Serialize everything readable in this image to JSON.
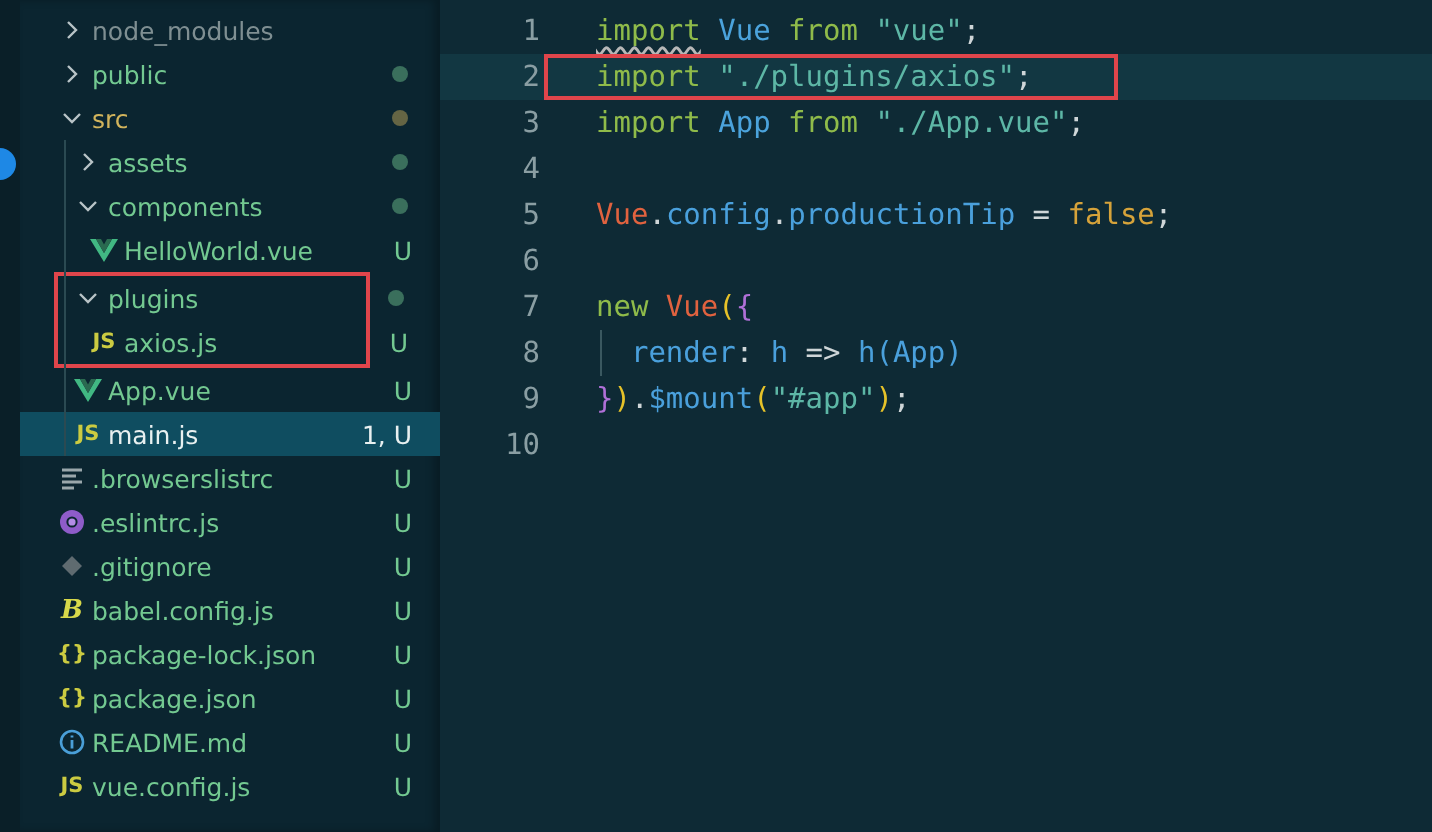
{
  "explorer": {
    "items": [
      {
        "label": "node_modules",
        "kind": "folder",
        "expanded": false,
        "color": "#7f8f92",
        "dot": false,
        "selected": false
      },
      {
        "label": "public",
        "kind": "folder",
        "expanded": false,
        "color": "#73c991",
        "dot": true,
        "selected": false
      },
      {
        "label": "src",
        "kind": "folder",
        "expanded": true,
        "color": "#d2b45c",
        "dot": true,
        "selected": false,
        "children": [
          {
            "label": "assets",
            "kind": "folder",
            "expanded": false,
            "color": "#73c991",
            "dot": true,
            "selected": false
          },
          {
            "label": "components",
            "kind": "folder",
            "expanded": true,
            "color": "#73c991",
            "dot": true,
            "selected": false,
            "children": [
              {
                "label": "HelloWorld.vue",
                "kind": "vue",
                "badge": "U",
                "color": "#73c991",
                "selected": false
              }
            ]
          },
          {
            "label": "plugins",
            "kind": "folder",
            "expanded": true,
            "color": "#73c991",
            "dot": true,
            "selected": false,
            "boxed": true,
            "children": [
              {
                "label": "axios.js",
                "kind": "js",
                "icon_glyph": "JS",
                "badge": "U",
                "color": "#73c991",
                "selected": false
              }
            ]
          },
          {
            "label": "App.vue",
            "kind": "vue",
            "badge": "U",
            "color": "#73c991",
            "selected": false
          },
          {
            "label": "main.js",
            "kind": "js",
            "icon_glyph": "JS",
            "badge": "1, U",
            "color": "#e8f0f0",
            "selected": true
          }
        ]
      },
      {
        "label": ".browserslistrc",
        "kind": "lines",
        "badge": "U",
        "color": "#73c991",
        "selected": false
      },
      {
        "label": ".eslintrc.js",
        "kind": "eslint",
        "badge": "U",
        "color": "#73c991",
        "selected": false
      },
      {
        "label": ".gitignore",
        "kind": "git",
        "badge": "U",
        "color": "#73c991",
        "selected": false
      },
      {
        "label": "babel.config.js",
        "kind": "babel",
        "icon_glyph": "B",
        "badge": "U",
        "color": "#73c991",
        "selected": false
      },
      {
        "label": "package-lock.json",
        "kind": "json",
        "icon_glyph": "{}",
        "badge": "U",
        "color": "#73c991",
        "selected": false
      },
      {
        "label": "package.json",
        "kind": "json",
        "icon_glyph": "{}",
        "badge": "U",
        "color": "#73c991",
        "selected": false
      },
      {
        "label": "README.md",
        "kind": "info",
        "badge": "U",
        "color": "#73c991",
        "selected": false
      },
      {
        "label": "vue.config.js",
        "kind": "js",
        "icon_glyph": "JS",
        "badge": "U",
        "color": "#73c991",
        "selected": false
      }
    ]
  },
  "editor": {
    "lines": [
      {
        "number": "1",
        "current": false,
        "boxed": false,
        "tokens": [
          {
            "t": "import",
            "kind": "kw",
            "warn": true
          },
          {
            "t": " Vue ",
            "kind": "cls"
          },
          {
            "t": "from ",
            "kind": "kw"
          },
          {
            "t": "\"vue\"",
            "kind": "str"
          },
          {
            "t": ";",
            "kind": "punc"
          }
        ]
      },
      {
        "number": "2",
        "current": true,
        "boxed": true,
        "tokens": [
          {
            "t": "import ",
            "kind": "kw"
          },
          {
            "t": "\"./plugins/axios\"",
            "kind": "str"
          },
          {
            "t": ";",
            "kind": "punc"
          }
        ]
      },
      {
        "number": "3",
        "current": false,
        "boxed": false,
        "tokens": [
          {
            "t": "import ",
            "kind": "kw"
          },
          {
            "t": "App ",
            "kind": "cls"
          },
          {
            "t": "from ",
            "kind": "kw"
          },
          {
            "t": "\"./App.vue\"",
            "kind": "str"
          },
          {
            "t": ";",
            "kind": "punc"
          }
        ]
      },
      {
        "number": "4",
        "current": false,
        "boxed": false
      },
      {
        "number": "5",
        "current": false,
        "boxed": false,
        "tokens": [
          {
            "t": "Vue",
            "kind": "obj"
          },
          {
            "t": ".",
            "kind": "punc"
          },
          {
            "t": "config",
            "kind": "prop"
          },
          {
            "t": ".",
            "kind": "punc"
          },
          {
            "t": "productionTip",
            "kind": "prop"
          },
          {
            "t": " = ",
            "kind": "punc"
          },
          {
            "t": "false",
            "kind": "bool"
          },
          {
            "t": ";",
            "kind": "punc"
          }
        ]
      },
      {
        "number": "6",
        "current": false,
        "boxed": false
      },
      {
        "number": "7",
        "current": false,
        "boxed": false,
        "tokens": [
          {
            "t": "new ",
            "kind": "kw"
          },
          {
            "t": "Vue",
            "kind": "obj"
          },
          {
            "t": "(",
            "kind": "br1"
          },
          {
            "t": "{",
            "kind": "br2"
          }
        ]
      },
      {
        "number": "8",
        "current": false,
        "boxed": false,
        "indent_guide": true,
        "tokens": [
          {
            "t": "  render",
            "kind": "prop"
          },
          {
            "t": ": ",
            "kind": "punc"
          },
          {
            "t": "h",
            "kind": "prop"
          },
          {
            "t": " => ",
            "kind": "punc"
          },
          {
            "t": "h",
            "kind": "prop"
          },
          {
            "t": "(",
            "kind": "br3"
          },
          {
            "t": "App",
            "kind": "prop"
          },
          {
            "t": ")",
            "kind": "br3"
          }
        ]
      },
      {
        "number": "9",
        "current": false,
        "boxed": false,
        "tokens": [
          {
            "t": "}",
            "kind": "br2"
          },
          {
            "t": ")",
            "kind": "br1"
          },
          {
            "t": ".",
            "kind": "punc"
          },
          {
            "t": "$mount",
            "kind": "prop"
          },
          {
            "t": "(",
            "kind": "br1"
          },
          {
            "t": "\"#app\"",
            "kind": "str"
          },
          {
            "t": ")",
            "kind": "br1"
          },
          {
            "t": ";",
            "kind": "punc"
          }
        ]
      },
      {
        "number": "10",
        "current": false,
        "boxed": false
      }
    ]
  }
}
